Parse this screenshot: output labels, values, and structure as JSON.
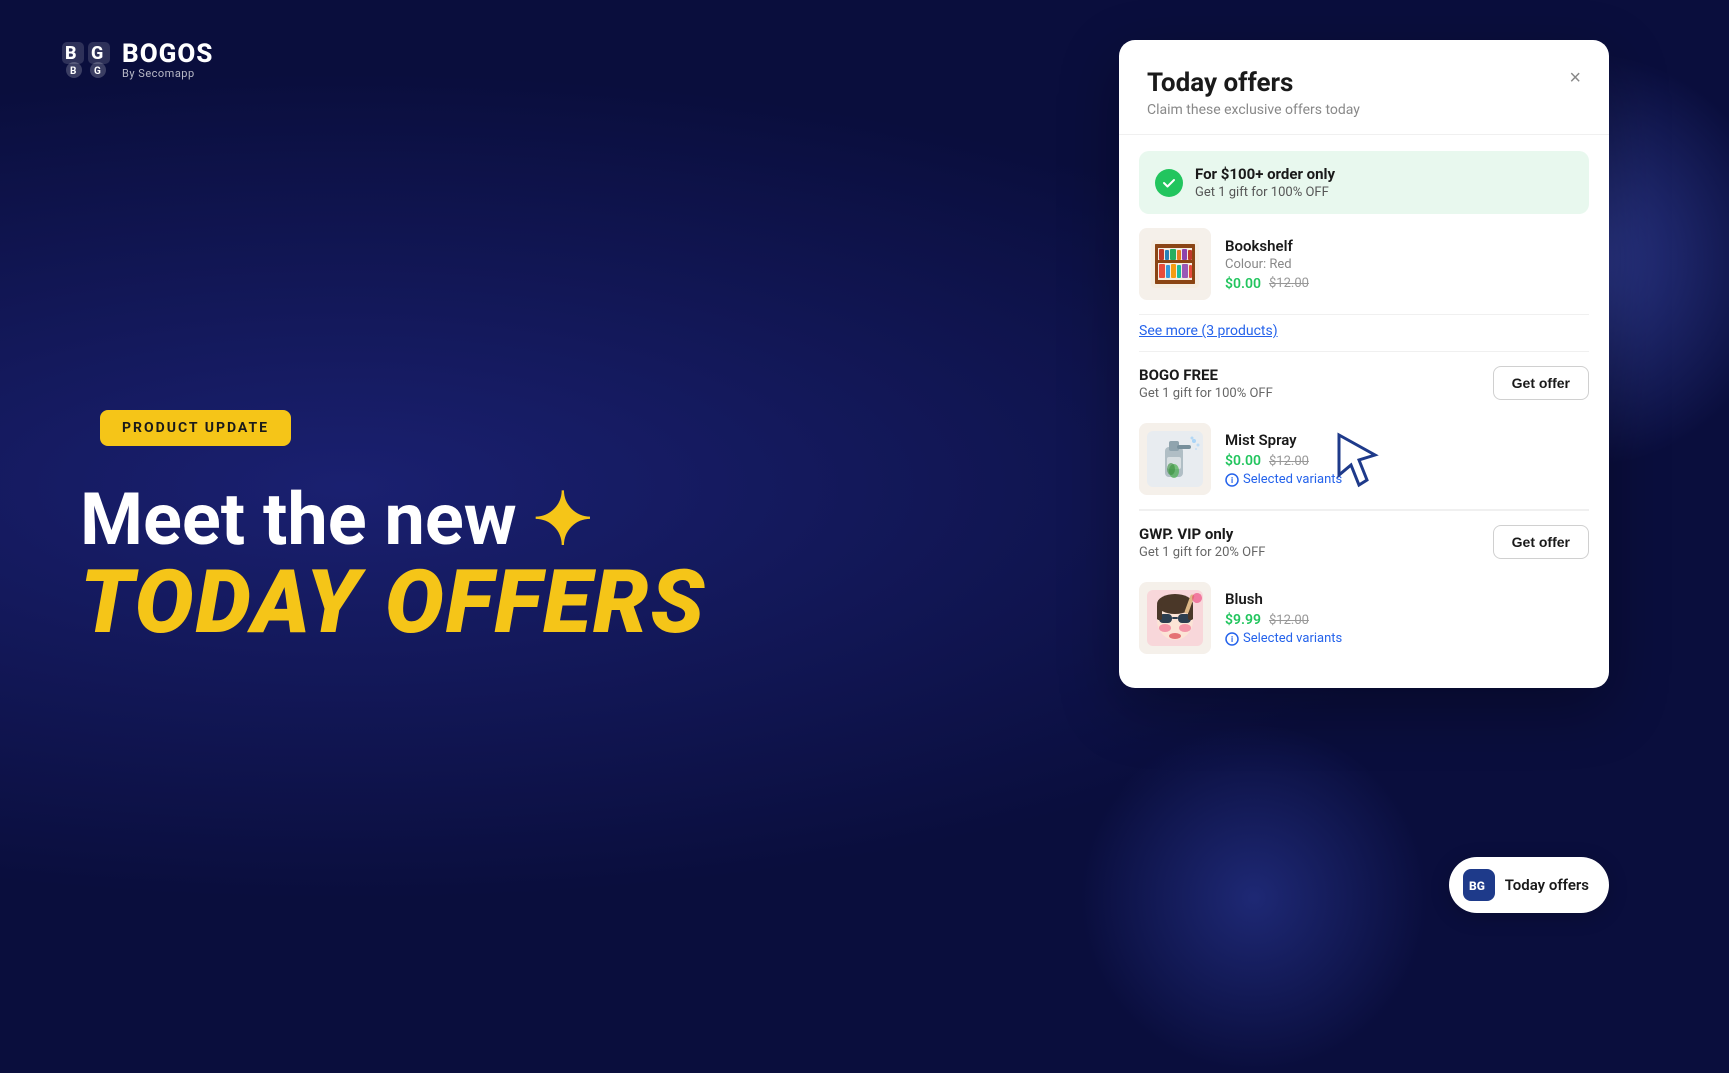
{
  "background": {
    "color": "#0a0e3d"
  },
  "logo": {
    "brand": "BOGOS",
    "sub": "By Secomapp"
  },
  "badge": {
    "label": "PRODUCT UPDATE"
  },
  "headline": {
    "line1": "Meet the new ✦",
    "line2": "TODAY OFFERS"
  },
  "modal": {
    "title": "Today offers",
    "subtitle": "Claim these exclusive offers today",
    "close_label": "×",
    "active_offer": {
      "title": "For $100+ order only",
      "description": "Get 1 gift for 100% OFF"
    },
    "active_product": {
      "name": "Bookshelf",
      "variant": "Colour: Red",
      "price_new": "$0.00",
      "price_old": "$12.00"
    },
    "see_more_label": "See more (3 products)",
    "offers": [
      {
        "title": "BOGO FREE",
        "description": "Get 1 gift for 100% OFF",
        "button_label": "Get offer",
        "product": {
          "name": "Mist Spray",
          "price_new": "$0.00",
          "price_old": "$12.00",
          "variants_label": "Selected variants"
        }
      },
      {
        "title": "GWP. VIP only",
        "description": "Get 1 gift for 20% OFF",
        "button_label": "Get offer",
        "product": {
          "name": "Blush",
          "price_new": "$9.99",
          "price_old": "$12.00",
          "variants_label": "Selected variants"
        }
      }
    ]
  },
  "floating_button": {
    "label": "Today offers"
  },
  "colors": {
    "green": "#22c55e",
    "blue_link": "#2563eb",
    "yellow": "#f5c518",
    "bg_dark": "#0a0e3d"
  }
}
